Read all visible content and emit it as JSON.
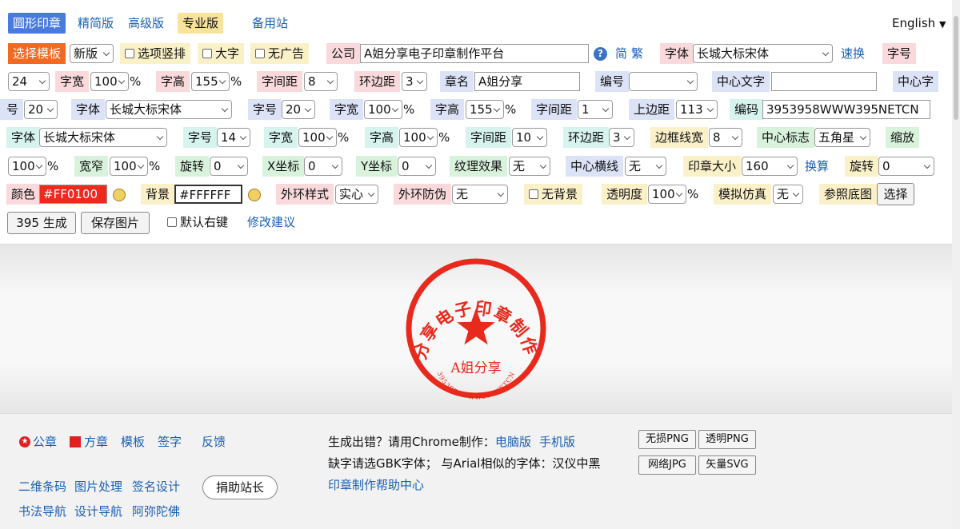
{
  "tabs": [
    "圆形印章",
    "精简版",
    "高级版",
    "专业版",
    "备用站"
  ],
  "language": "English",
  "row1": {
    "template_btn": "选择模板",
    "template_val": "新版",
    "opt_vertical": "选项竖排",
    "opt_big": "大字",
    "opt_noad": "无广告",
    "company_lbl": "公司",
    "company_val": "A姐分享电子印章制作平台",
    "simp": "简",
    "trad": "繁",
    "font_lbl": "字体",
    "font_val": "长城大标宋体",
    "fast": "速换",
    "size_lbl": "字号"
  },
  "row2": {
    "size_val": "24",
    "width_lbl": "字宽",
    "width_val": "100",
    "pct": "%",
    "height_lbl": "字高",
    "height_val": "155",
    "spacing_lbl": "字间距",
    "spacing_val": "8",
    "ring_lbl": "环边距",
    "ring_val": "3",
    "chapter_lbl": "章名",
    "chapter_val": "A姐分享",
    "num_lbl": "编号",
    "center_lbl": "中心文字",
    "center_font_lbl": "中心字"
  },
  "row3": {
    "center_font_lbl2": "号",
    "center_size_val": "20",
    "font_lbl": "字体",
    "font_val": "长城大标宋体",
    "size_lbl": "字号",
    "size_val": "20",
    "width_lbl": "字宽",
    "width_val": "100",
    "height_lbl": "字高",
    "height_val": "155",
    "spacing_lbl": "字间距",
    "spacing_val": "1",
    "top_lbl": "上边距",
    "top_val": "113",
    "code_lbl": "编码",
    "code_val": "3953958WWW395NETCN"
  },
  "row4": {
    "font_lbl": "字体",
    "font_val": "长城大标宋体",
    "size_lbl": "字号",
    "size_val": "14",
    "width_lbl": "字宽",
    "width_val": "100",
    "height_lbl": "字高",
    "height_val": "100",
    "spacing_lbl": "字间距",
    "spacing_val": "10",
    "ring_lbl": "环边距",
    "ring_val": "3",
    "border_lbl": "边框线宽",
    "border_val": "8",
    "mark_lbl": "中心标志",
    "mark_val": "五角星",
    "zoom_lbl": "缩放"
  },
  "row5": {
    "zoom_val": "100",
    "narrow_lbl": "宽窄",
    "narrow_val": "100",
    "rotate_lbl": "旋转",
    "rotate_val": "0",
    "x_lbl": "X坐标",
    "x_val": "0",
    "y_lbl": "Y坐标",
    "y_val": "0",
    "texture_lbl": "纹理效果",
    "texture_val": "无",
    "hline_lbl": "中心横线",
    "hline_val": "无",
    "stamp_size_lbl": "印章大小",
    "stamp_size_val": "160",
    "convert": "换算",
    "rotate2_lbl": "旋转",
    "rotate2_val": "0"
  },
  "row6": {
    "color_lbl": "颜色",
    "color_val": "#FF0100",
    "bg_lbl": "背景",
    "bg_val": "#FFFFFF",
    "outer_lbl": "外环样式",
    "outer_val": "实心",
    "anti_lbl": "外环防伪",
    "anti_val": "无",
    "nobg": "无背景",
    "opacity_lbl": "透明度",
    "opacity_val": "100",
    "sim_lbl": "模拟仿真",
    "sim_val": "无",
    "ref_lbl": "参照底图",
    "ref_btn": "选择"
  },
  "row7": {
    "gen_btn": "395 生成",
    "save_btn": "保存图片",
    "rightkey": "默认右键",
    "suggest": "修改建议"
  },
  "seal": {
    "color": "#e8291c",
    "top_text": "A姐分享电子印章制作平台",
    "name": "A姐分享",
    "code": "3953958WWW395NETCN"
  },
  "footer": {
    "official": "公章",
    "square": "方章",
    "template": "模板",
    "sign": "签字",
    "feedback": "反馈",
    "qr": "二维条码",
    "img": "图片处理",
    "signdesign": "签名设计",
    "donate": "捐助站长",
    "calli": "书法导航",
    "designnav": "设计导航",
    "amitabha": "阿弥陀佛",
    "err_text": "生成出错？请用Chrome制作：",
    "pc": "电脑版",
    "mobile": "手机版",
    "gbk_text": "缺字请选GBK字体； 与Arial相似的字体：汉仪中黑",
    "help": "印章制作帮助中心",
    "png": "无损PNG",
    "tpng": "透明PNG",
    "jpg": "网络JPG",
    "svg": "矢量SVG"
  }
}
